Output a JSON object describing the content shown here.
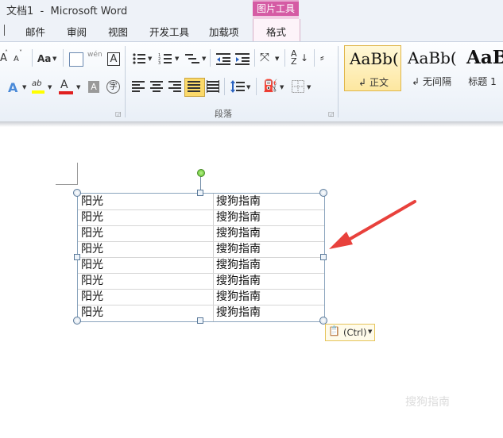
{
  "window": {
    "title": "文档1  -  Microsoft Word"
  },
  "contextual_tab": {
    "label": "图片工具"
  },
  "tabs": [
    {
      "id": "mailings",
      "label": "邮件"
    },
    {
      "id": "review",
      "label": "审阅"
    },
    {
      "id": "view",
      "label": "视图"
    },
    {
      "id": "developer",
      "label": "开发工具"
    },
    {
      "id": "addins",
      "label": "加载项"
    },
    {
      "id": "format",
      "label": "格式"
    }
  ],
  "ribbon": {
    "font_group": {
      "grow_font": "A",
      "shrink_font": "A",
      "change_case": "Aa",
      "phonetic_guide": "wén",
      "char_border": "A",
      "text_effect": "A",
      "highlight": "ab",
      "font_color": "A",
      "char_shading": "A",
      "enclose_char": "字"
    },
    "paragraph_group": {
      "label": "段落"
    },
    "styles": [
      {
        "sample": "AaBb(",
        "name": "正文",
        "selected": true
      },
      {
        "sample": "AaBb(",
        "name": "无间隔",
        "selected": false
      },
      {
        "sample": "AaB",
        "name": "标题 1",
        "selected": false
      }
    ],
    "style_prefix_mark": "↲"
  },
  "document": {
    "table_rows": [
      {
        "col1": "阳光",
        "col2": "搜狗指南"
      },
      {
        "col1": "阳光",
        "col2": "搜狗指南"
      },
      {
        "col1": "阳光",
        "col2": "搜狗指南"
      },
      {
        "col1": "阳光",
        "col2": "搜狗指南"
      },
      {
        "col1": "阳光",
        "col2": "搜狗指南"
      },
      {
        "col1": "阳光",
        "col2": "搜狗指南"
      },
      {
        "col1": "阳光",
        "col2": "搜狗指南"
      },
      {
        "col1": "阳光",
        "col2": "搜狗指南"
      }
    ],
    "paste_options": {
      "label": "(Ctrl)"
    },
    "annotation_arrow_color": "#e8413c"
  },
  "watermark": {
    "text": "搜狗指南"
  },
  "colors": {
    "contextual_tab": "#d55ba4",
    "highlight_yellow": "#ffff00",
    "font_color_red": "#e02020",
    "selected_button": "#fbd96a"
  }
}
